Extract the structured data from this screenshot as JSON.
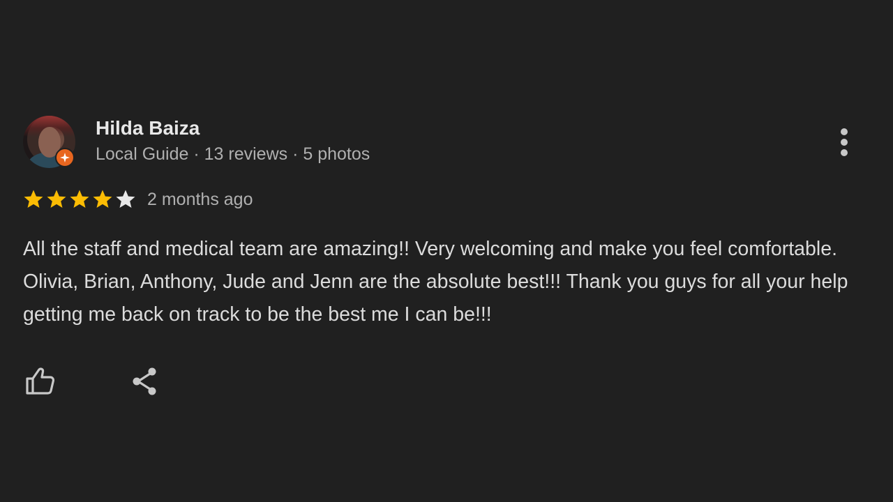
{
  "reviewer": {
    "name": "Hilda Baiza",
    "meta": "Local Guide · 13 reviews · 5 photos",
    "badge": "local-guide-badge-icon"
  },
  "review": {
    "rating": 4,
    "max_rating": 5,
    "date": "2 months ago",
    "text": "All the staff and medical team are amazing!! Very welcoming and make you feel comfortable. Olivia, Brian, Anthony, Jude and Jenn are the absolute best!!! Thank you guys for all your help getting me back on track to be the best me I can be!!!"
  },
  "actions": {
    "like_icon": "thumbs-up-icon",
    "share_icon": "share-icon",
    "more_icon": "more-vert-icon"
  },
  "colors": {
    "background": "#202020",
    "star_filled": "#fbbc04",
    "star_empty": "#e8e8e8",
    "badge": "#e8661f",
    "text_primary": "#e8e8e8",
    "text_secondary": "#b0b0b0"
  }
}
